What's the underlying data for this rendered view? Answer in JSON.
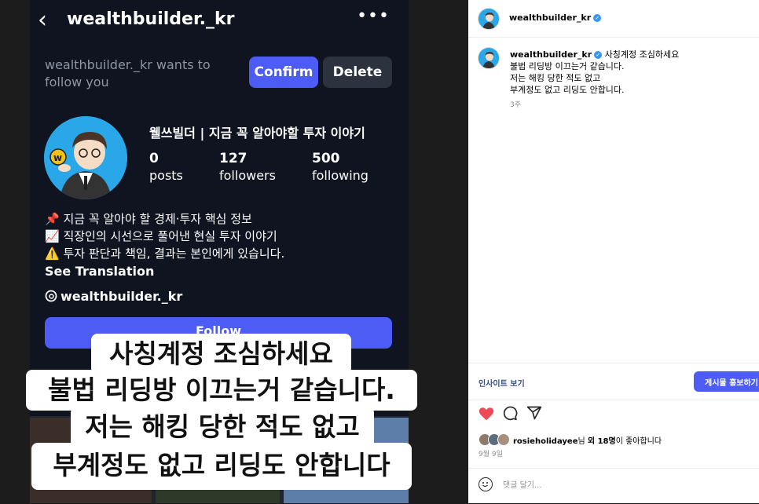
{
  "phone": {
    "back_icon": "chevron-left-icon",
    "handle": "wealthbuilder._kr",
    "more_icon": "ellipsis-icon",
    "request_text": "wealthbuilder._kr wants to follow you",
    "confirm_label": "Confirm",
    "delete_label": "Delete",
    "display_name": "웰쓰빌더 | 지금 꼭 알아야할 투자 이야기",
    "stats": [
      {
        "num": "0",
        "label": "posts"
      },
      {
        "num": "127",
        "label": "followers"
      },
      {
        "num": "500",
        "label": "following"
      }
    ],
    "bio": [
      "📌 지금 꼭 알아야 할 경제·투자 핵심 정보",
      "📈 직장인의 시선으로 풀어낸 현실 투자 이야기",
      "⚠️ 투자 판단과 책임, 결과는 본인에게 있습니다."
    ],
    "see_translation": "See Translation",
    "threads_handle": "wealthbuilder._kr",
    "follow_label": "Follow"
  },
  "caption": {
    "lines": [
      "사칭계정 조심하세요",
      "불법 리딩방 이끄는거 같습니다.",
      "저는 해킹 당한 적도 없고",
      "부계정도 없고 리딩도 안합니다"
    ]
  },
  "post": {
    "header_user": "wealthbuilder_kr",
    "comment_user": "wealthbuilder_kr",
    "comment_lines": [
      "사칭계정 조심하세요",
      "불법 리딩방 이끄는거 같습니다.",
      "저는 해킹 당한 적도 없고",
      "부계정도 없고 리딩도 안합니다."
    ],
    "comment_time": "3주",
    "insight_link": "인사이트 보기",
    "promote_label": "게시물 홍보하기",
    "likes_user": "rosieholidayee",
    "likes_mid": "님 ",
    "likes_count": "외 18명",
    "likes_suffix": "이 좋아합니다",
    "date": "9월 9일",
    "comment_placeholder": "댓글 달기...",
    "accent": "#4c5cf5",
    "heart_color": "#ed4956"
  }
}
